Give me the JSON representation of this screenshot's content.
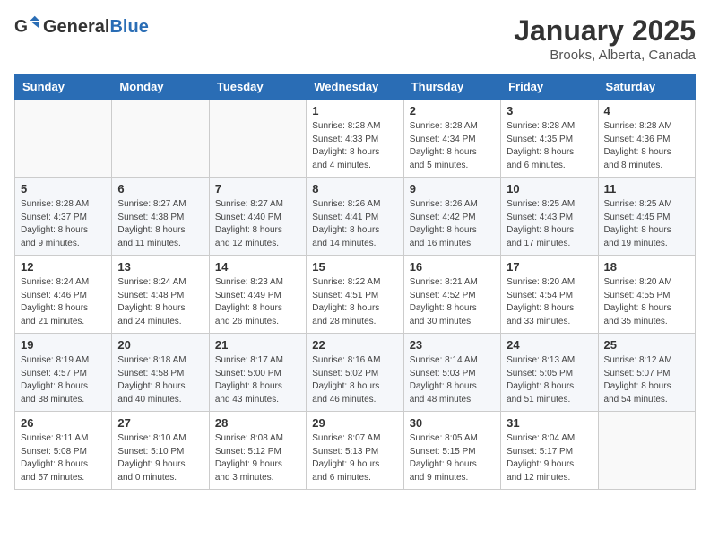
{
  "header": {
    "logo_general": "General",
    "logo_blue": "Blue",
    "month_year": "January 2025",
    "location": "Brooks, Alberta, Canada"
  },
  "weekdays": [
    "Sunday",
    "Monday",
    "Tuesday",
    "Wednesday",
    "Thursday",
    "Friday",
    "Saturday"
  ],
  "weeks": [
    [
      {
        "day": "",
        "info": ""
      },
      {
        "day": "",
        "info": ""
      },
      {
        "day": "",
        "info": ""
      },
      {
        "day": "1",
        "info": "Sunrise: 8:28 AM\nSunset: 4:33 PM\nDaylight: 8 hours\nand 4 minutes."
      },
      {
        "day": "2",
        "info": "Sunrise: 8:28 AM\nSunset: 4:34 PM\nDaylight: 8 hours\nand 5 minutes."
      },
      {
        "day": "3",
        "info": "Sunrise: 8:28 AM\nSunset: 4:35 PM\nDaylight: 8 hours\nand 6 minutes."
      },
      {
        "day": "4",
        "info": "Sunrise: 8:28 AM\nSunset: 4:36 PM\nDaylight: 8 hours\nand 8 minutes."
      }
    ],
    [
      {
        "day": "5",
        "info": "Sunrise: 8:28 AM\nSunset: 4:37 PM\nDaylight: 8 hours\nand 9 minutes."
      },
      {
        "day": "6",
        "info": "Sunrise: 8:27 AM\nSunset: 4:38 PM\nDaylight: 8 hours\nand 11 minutes."
      },
      {
        "day": "7",
        "info": "Sunrise: 8:27 AM\nSunset: 4:40 PM\nDaylight: 8 hours\nand 12 minutes."
      },
      {
        "day": "8",
        "info": "Sunrise: 8:26 AM\nSunset: 4:41 PM\nDaylight: 8 hours\nand 14 minutes."
      },
      {
        "day": "9",
        "info": "Sunrise: 8:26 AM\nSunset: 4:42 PM\nDaylight: 8 hours\nand 16 minutes."
      },
      {
        "day": "10",
        "info": "Sunrise: 8:25 AM\nSunset: 4:43 PM\nDaylight: 8 hours\nand 17 minutes."
      },
      {
        "day": "11",
        "info": "Sunrise: 8:25 AM\nSunset: 4:45 PM\nDaylight: 8 hours\nand 19 minutes."
      }
    ],
    [
      {
        "day": "12",
        "info": "Sunrise: 8:24 AM\nSunset: 4:46 PM\nDaylight: 8 hours\nand 21 minutes."
      },
      {
        "day": "13",
        "info": "Sunrise: 8:24 AM\nSunset: 4:48 PM\nDaylight: 8 hours\nand 24 minutes."
      },
      {
        "day": "14",
        "info": "Sunrise: 8:23 AM\nSunset: 4:49 PM\nDaylight: 8 hours\nand 26 minutes."
      },
      {
        "day": "15",
        "info": "Sunrise: 8:22 AM\nSunset: 4:51 PM\nDaylight: 8 hours\nand 28 minutes."
      },
      {
        "day": "16",
        "info": "Sunrise: 8:21 AM\nSunset: 4:52 PM\nDaylight: 8 hours\nand 30 minutes."
      },
      {
        "day": "17",
        "info": "Sunrise: 8:20 AM\nSunset: 4:54 PM\nDaylight: 8 hours\nand 33 minutes."
      },
      {
        "day": "18",
        "info": "Sunrise: 8:20 AM\nSunset: 4:55 PM\nDaylight: 8 hours\nand 35 minutes."
      }
    ],
    [
      {
        "day": "19",
        "info": "Sunrise: 8:19 AM\nSunset: 4:57 PM\nDaylight: 8 hours\nand 38 minutes."
      },
      {
        "day": "20",
        "info": "Sunrise: 8:18 AM\nSunset: 4:58 PM\nDaylight: 8 hours\nand 40 minutes."
      },
      {
        "day": "21",
        "info": "Sunrise: 8:17 AM\nSunset: 5:00 PM\nDaylight: 8 hours\nand 43 minutes."
      },
      {
        "day": "22",
        "info": "Sunrise: 8:16 AM\nSunset: 5:02 PM\nDaylight: 8 hours\nand 46 minutes."
      },
      {
        "day": "23",
        "info": "Sunrise: 8:14 AM\nSunset: 5:03 PM\nDaylight: 8 hours\nand 48 minutes."
      },
      {
        "day": "24",
        "info": "Sunrise: 8:13 AM\nSunset: 5:05 PM\nDaylight: 8 hours\nand 51 minutes."
      },
      {
        "day": "25",
        "info": "Sunrise: 8:12 AM\nSunset: 5:07 PM\nDaylight: 8 hours\nand 54 minutes."
      }
    ],
    [
      {
        "day": "26",
        "info": "Sunrise: 8:11 AM\nSunset: 5:08 PM\nDaylight: 8 hours\nand 57 minutes."
      },
      {
        "day": "27",
        "info": "Sunrise: 8:10 AM\nSunset: 5:10 PM\nDaylight: 9 hours\nand 0 minutes."
      },
      {
        "day": "28",
        "info": "Sunrise: 8:08 AM\nSunset: 5:12 PM\nDaylight: 9 hours\nand 3 minutes."
      },
      {
        "day": "29",
        "info": "Sunrise: 8:07 AM\nSunset: 5:13 PM\nDaylight: 9 hours\nand 6 minutes."
      },
      {
        "day": "30",
        "info": "Sunrise: 8:05 AM\nSunset: 5:15 PM\nDaylight: 9 hours\nand 9 minutes."
      },
      {
        "day": "31",
        "info": "Sunrise: 8:04 AM\nSunset: 5:17 PM\nDaylight: 9 hours\nand 12 minutes."
      },
      {
        "day": "",
        "info": ""
      }
    ]
  ]
}
